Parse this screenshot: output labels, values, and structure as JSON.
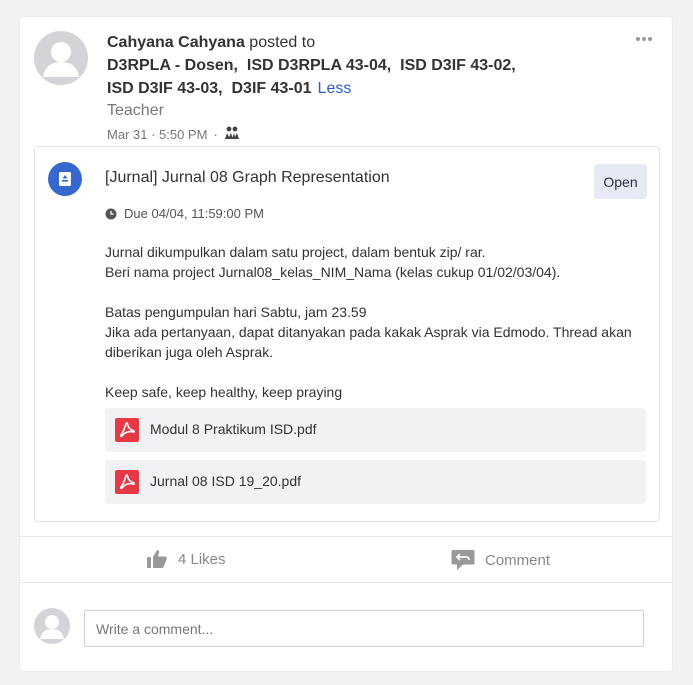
{
  "post": {
    "author": "Cahyana Cahyana",
    "posted_to": " posted to",
    "groups": [
      "D3RPLA - Dosen",
      "ISD D3RPLA 43-04",
      "ISD D3IF 43-02",
      "ISD D3IF 43-03",
      "D3IF 43-01"
    ],
    "less_label": "Less",
    "role": "Teacher",
    "date": "Mar 31 · 5:50 PM",
    "separator": "·"
  },
  "assignment": {
    "title": "[Jurnal] Jurnal 08 Graph Representation",
    "open_label": "Open",
    "due": "Due 04/04, 11:59:00 PM",
    "body": [
      "Jurnal dikumpulkan dalam satu project, dalam bentuk zip/ rar.",
      "Beri nama project Jurnal08_kelas_NIM_Nama (kelas cukup 01/02/03/04).",
      "",
      "Batas pengumpulan hari Sabtu, jam 23.59",
      "Jika ada pertanyaan, dapat ditanyakan pada kakak Asprak via Edmodo. Thread akan diberikan juga oleh Asprak.",
      "",
      "Keep safe, keep healthy, keep praying"
    ],
    "attachments": [
      {
        "name": "Modul 8 Praktikum ISD.pdf",
        "icon": "pdf-icon"
      },
      {
        "name": "Jurnal 08 ISD 19_20.pdf",
        "icon": "pdf-icon"
      }
    ],
    "icon_color": "#3768cd"
  },
  "actions": {
    "likes_label": "4 Likes",
    "comment_label": "Comment"
  },
  "comment_box": {
    "placeholder": "Write a comment..."
  },
  "colors": {
    "accent": "#2e5ccc",
    "pdf": "#e63946"
  }
}
